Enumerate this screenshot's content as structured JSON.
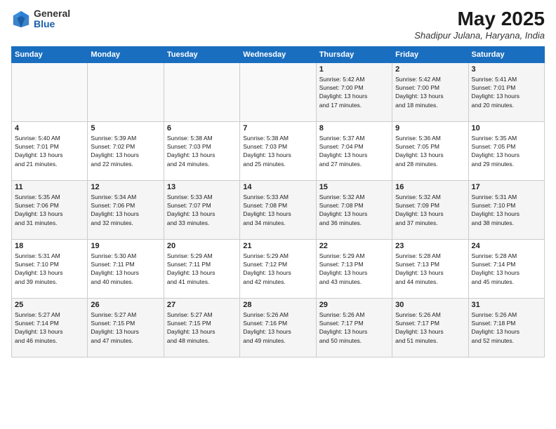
{
  "logo": {
    "general": "General",
    "blue": "Blue"
  },
  "title": "May 2025",
  "location": "Shadipur Julana, Haryana, India",
  "days_of_week": [
    "Sunday",
    "Monday",
    "Tuesday",
    "Wednesday",
    "Thursday",
    "Friday",
    "Saturday"
  ],
  "weeks": [
    [
      {
        "day": "",
        "info": ""
      },
      {
        "day": "",
        "info": ""
      },
      {
        "day": "",
        "info": ""
      },
      {
        "day": "",
        "info": ""
      },
      {
        "day": "1",
        "info": "Sunrise: 5:42 AM\nSunset: 7:00 PM\nDaylight: 13 hours\nand 17 minutes."
      },
      {
        "day": "2",
        "info": "Sunrise: 5:42 AM\nSunset: 7:00 PM\nDaylight: 13 hours\nand 18 minutes."
      },
      {
        "day": "3",
        "info": "Sunrise: 5:41 AM\nSunset: 7:01 PM\nDaylight: 13 hours\nand 20 minutes."
      }
    ],
    [
      {
        "day": "4",
        "info": "Sunrise: 5:40 AM\nSunset: 7:01 PM\nDaylight: 13 hours\nand 21 minutes."
      },
      {
        "day": "5",
        "info": "Sunrise: 5:39 AM\nSunset: 7:02 PM\nDaylight: 13 hours\nand 22 minutes."
      },
      {
        "day": "6",
        "info": "Sunrise: 5:38 AM\nSunset: 7:03 PM\nDaylight: 13 hours\nand 24 minutes."
      },
      {
        "day": "7",
        "info": "Sunrise: 5:38 AM\nSunset: 7:03 PM\nDaylight: 13 hours\nand 25 minutes."
      },
      {
        "day": "8",
        "info": "Sunrise: 5:37 AM\nSunset: 7:04 PM\nDaylight: 13 hours\nand 27 minutes."
      },
      {
        "day": "9",
        "info": "Sunrise: 5:36 AM\nSunset: 7:05 PM\nDaylight: 13 hours\nand 28 minutes."
      },
      {
        "day": "10",
        "info": "Sunrise: 5:35 AM\nSunset: 7:05 PM\nDaylight: 13 hours\nand 29 minutes."
      }
    ],
    [
      {
        "day": "11",
        "info": "Sunrise: 5:35 AM\nSunset: 7:06 PM\nDaylight: 13 hours\nand 31 minutes."
      },
      {
        "day": "12",
        "info": "Sunrise: 5:34 AM\nSunset: 7:06 PM\nDaylight: 13 hours\nand 32 minutes."
      },
      {
        "day": "13",
        "info": "Sunrise: 5:33 AM\nSunset: 7:07 PM\nDaylight: 13 hours\nand 33 minutes."
      },
      {
        "day": "14",
        "info": "Sunrise: 5:33 AM\nSunset: 7:08 PM\nDaylight: 13 hours\nand 34 minutes."
      },
      {
        "day": "15",
        "info": "Sunrise: 5:32 AM\nSunset: 7:08 PM\nDaylight: 13 hours\nand 36 minutes."
      },
      {
        "day": "16",
        "info": "Sunrise: 5:32 AM\nSunset: 7:09 PM\nDaylight: 13 hours\nand 37 minutes."
      },
      {
        "day": "17",
        "info": "Sunrise: 5:31 AM\nSunset: 7:10 PM\nDaylight: 13 hours\nand 38 minutes."
      }
    ],
    [
      {
        "day": "18",
        "info": "Sunrise: 5:31 AM\nSunset: 7:10 PM\nDaylight: 13 hours\nand 39 minutes."
      },
      {
        "day": "19",
        "info": "Sunrise: 5:30 AM\nSunset: 7:11 PM\nDaylight: 13 hours\nand 40 minutes."
      },
      {
        "day": "20",
        "info": "Sunrise: 5:29 AM\nSunset: 7:11 PM\nDaylight: 13 hours\nand 41 minutes."
      },
      {
        "day": "21",
        "info": "Sunrise: 5:29 AM\nSunset: 7:12 PM\nDaylight: 13 hours\nand 42 minutes."
      },
      {
        "day": "22",
        "info": "Sunrise: 5:29 AM\nSunset: 7:13 PM\nDaylight: 13 hours\nand 43 minutes."
      },
      {
        "day": "23",
        "info": "Sunrise: 5:28 AM\nSunset: 7:13 PM\nDaylight: 13 hours\nand 44 minutes."
      },
      {
        "day": "24",
        "info": "Sunrise: 5:28 AM\nSunset: 7:14 PM\nDaylight: 13 hours\nand 45 minutes."
      }
    ],
    [
      {
        "day": "25",
        "info": "Sunrise: 5:27 AM\nSunset: 7:14 PM\nDaylight: 13 hours\nand 46 minutes."
      },
      {
        "day": "26",
        "info": "Sunrise: 5:27 AM\nSunset: 7:15 PM\nDaylight: 13 hours\nand 47 minutes."
      },
      {
        "day": "27",
        "info": "Sunrise: 5:27 AM\nSunset: 7:15 PM\nDaylight: 13 hours\nand 48 minutes."
      },
      {
        "day": "28",
        "info": "Sunrise: 5:26 AM\nSunset: 7:16 PM\nDaylight: 13 hours\nand 49 minutes."
      },
      {
        "day": "29",
        "info": "Sunrise: 5:26 AM\nSunset: 7:17 PM\nDaylight: 13 hours\nand 50 minutes."
      },
      {
        "day": "30",
        "info": "Sunrise: 5:26 AM\nSunset: 7:17 PM\nDaylight: 13 hours\nand 51 minutes."
      },
      {
        "day": "31",
        "info": "Sunrise: 5:26 AM\nSunset: 7:18 PM\nDaylight: 13 hours\nand 52 minutes."
      }
    ]
  ]
}
